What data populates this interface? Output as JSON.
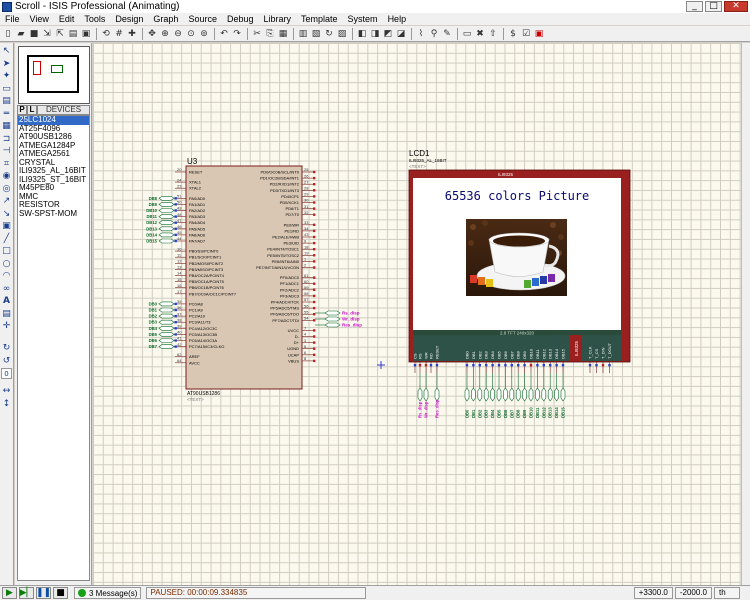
{
  "window": {
    "title": "Scroll - ISIS Professional (Animating)"
  },
  "menu": [
    "File",
    "View",
    "Edit",
    "Tools",
    "Design",
    "Graph",
    "Source",
    "Debug",
    "Library",
    "Template",
    "System",
    "Help"
  ],
  "device_panel": {
    "tab_p": "P",
    "tab_l": "L",
    "header": "DEVICES",
    "items": [
      "25LC1024",
      "AT25F4096",
      "AT90USB1286",
      "ATMEGA1284P",
      "ATMEGA2561",
      "CRYSTAL",
      "ILI9325_AL_16BIT",
      "ILI9325_ST_16BIT",
      "M45PE80",
      "MMC",
      "RESISTOR",
      "SW-SPST-MOM"
    ],
    "selected": 0
  },
  "schematic": {
    "u3": {
      "ref": "U3",
      "part": "AT90USB1286",
      "text_tag": "<TEXT>",
      "left_pins": [
        {
          "num": "20",
          "name": "RESET"
        },
        {
          "num": "24",
          "name": "XTAL1"
        },
        {
          "num": "23",
          "name": "XTAL2"
        },
        {
          "num": "51",
          "name": "PA0/AD0"
        },
        {
          "num": "50",
          "name": "PA1/AD1"
        },
        {
          "num": "49",
          "name": "PA2/AD2"
        },
        {
          "num": "48",
          "name": "PA3/AD3"
        },
        {
          "num": "47",
          "name": "PA4/AD4"
        },
        {
          "num": "46",
          "name": "PA5/AD5"
        },
        {
          "num": "45",
          "name": "PA6/AD6"
        },
        {
          "num": "44",
          "name": "PA7/AD7"
        },
        {
          "num": "10",
          "name": "PB0/SS/PCINT0"
        },
        {
          "num": "11",
          "name": "PB1/SCK/PCINT1"
        },
        {
          "num": "12",
          "name": "PB2/MOSI/PCINT2"
        },
        {
          "num": "13",
          "name": "PB3/MISO/PCINT3"
        },
        {
          "num": "14",
          "name": "PB4/OC2A/PCINT4"
        },
        {
          "num": "15",
          "name": "PB5/OC1A/PCINT5"
        },
        {
          "num": "16",
          "name": "PB6/OC1B/PCINT6"
        },
        {
          "num": "17",
          "name": "PB7/OC0A/OC1C/PCINT7"
        },
        {
          "num": "35",
          "name": "PC0/A8"
        },
        {
          "num": "36",
          "name": "PC1/A9"
        },
        {
          "num": "37",
          "name": "PC2/A10"
        },
        {
          "num": "38",
          "name": "PC3/A11/T3"
        },
        {
          "num": "39",
          "name": "PC4/A12/OC3C"
        },
        {
          "num": "40",
          "name": "PC5/A13/OC3B"
        },
        {
          "num": "41",
          "name": "PC6/A14/OC3A"
        },
        {
          "num": "42",
          "name": "PC7/A15/IC3/CLKO"
        },
        {
          "num": "62",
          "name": "AREF"
        },
        {
          "num": "64",
          "name": "AVCC"
        }
      ],
      "right_pins": [
        {
          "num": "25",
          "name": "PD0/OC0B/SCL/INT0"
        },
        {
          "num": "26",
          "name": "PD1/OC2B/SDA/INT1"
        },
        {
          "num": "27",
          "name": "PD2/RXD1/INT2"
        },
        {
          "num": "28",
          "name": "PD3/TXD1/INT3"
        },
        {
          "num": "29",
          "name": "PD4/ICP1"
        },
        {
          "num": "30",
          "name": "PD5/XCK1"
        },
        {
          "num": "31",
          "name": "PD6/T1"
        },
        {
          "num": "32",
          "name": "PD7/T0"
        },
        {
          "num": "33",
          "name": "PE0/WR"
        },
        {
          "num": "34",
          "name": "PE1/RD"
        },
        {
          "num": "43",
          "name": "PE2/ALE/HWB"
        },
        {
          "num": "9",
          "name": "PE3/UID"
        },
        {
          "num": "18",
          "name": "PE4/INT4/TOSC1"
        },
        {
          "num": "19",
          "name": "PE5/INT5/TOSC2"
        },
        {
          "num": "1",
          "name": "PE6/INT6/AIN0"
        },
        {
          "num": "2",
          "name": "PE7/INT7/AIN1/UVCON"
        },
        {
          "num": "61",
          "name": "PF0/ADC0"
        },
        {
          "num": "60",
          "name": "PF1/ADC1"
        },
        {
          "num": "59",
          "name": "PF2/ADC2"
        },
        {
          "num": "58",
          "name": "PF3/ADC3"
        },
        {
          "num": "57",
          "name": "PF4/ADC4/TCK"
        },
        {
          "num": "56",
          "name": "PF5/ADC5/TMS"
        },
        {
          "num": "55",
          "name": "PF6/ADC6/TDO"
        },
        {
          "num": "54",
          "name": "PF7/ADC7/TDI"
        },
        {
          "num": "7",
          "name": "UVCC"
        },
        {
          "num": "4",
          "name": "D-"
        },
        {
          "num": "3",
          "name": "D+"
        },
        {
          "num": "5",
          "name": "UGND"
        },
        {
          "num": "6",
          "name": "UCAP"
        },
        {
          "num": "8",
          "name": "VBUS"
        }
      ],
      "left_nets_top": [
        "DB8",
        "DB9",
        "DB10",
        "DB11",
        "DB12",
        "DB13",
        "DB14",
        "DB15"
      ],
      "left_nets_bottom": [
        "DB0",
        "DB1",
        "DB2",
        "DB3",
        "DB4",
        "DB5",
        "DB6",
        "DB7"
      ],
      "right_nets": [
        "Rs_disp",
        "Wr_disp",
        "Res_disp"
      ]
    },
    "lcd": {
      "ref": "LCD1",
      "part": "ILI9325_AL_16BIT",
      "text_tag": "<TEXT>",
      "header_chip": "ILI9325",
      "screen_text": "65536 colors Picture",
      "footer": "2.8 TFT 240x320",
      "brand": "ILI9325",
      "bottom_pins_left": [
        "CS",
        "RS",
        "WR",
        "RD",
        "RESET"
      ],
      "bottom_pins_data": [
        "DB0",
        "DB1",
        "DB2",
        "DB3",
        "DB4",
        "DB5",
        "DB6",
        "DB7",
        "DB8",
        "DB9",
        "DB10",
        "DB11",
        "DB12",
        "DB13",
        "DB14",
        "DB15"
      ],
      "bottom_pins_right": [
        "T_CLK",
        "T_CS",
        "T_DIN",
        "T_DOUT"
      ],
      "nets_left": [
        "Rs_disp",
        "Wr_disp",
        "Res_disp"
      ],
      "nets_data": [
        "DB0",
        "DB1",
        "DB2",
        "DB3",
        "DB4",
        "DB5",
        "DB6",
        "DB7",
        "DB8",
        "DB9",
        "DB10",
        "DB11",
        "DB12",
        "DB13",
        "DB14",
        "DB15"
      ]
    }
  },
  "status": {
    "messages": "3 Message(s)",
    "sim_state": "PAUSED: 00:00:09.334835",
    "coord_x": "+3300.0",
    "coord_y": "-2000.0",
    "units": "th"
  }
}
